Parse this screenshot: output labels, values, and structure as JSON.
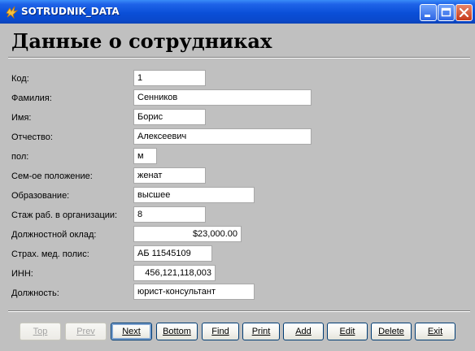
{
  "window": {
    "title": "SOTRUDNIK_DATA",
    "controls": {
      "minimize_icon": "minimize-icon",
      "maximize_icon": "maximize-icon",
      "close_icon": "close-icon"
    }
  },
  "form": {
    "heading": "Данные о сотрудниках",
    "fields": [
      {
        "label": "Код:",
        "value": "1"
      },
      {
        "label": "Фамилия:",
        "value": "Сенников"
      },
      {
        "label": "Имя:",
        "value": "Борис"
      },
      {
        "label": "Отчество:",
        "value": "Алексеевич"
      },
      {
        "label": "пол:",
        "value": "м"
      },
      {
        "label": "Сем-ое положение:",
        "value": "женат"
      },
      {
        "label": "Образование:",
        "value": "высшее"
      },
      {
        "label": "Стаж раб. в организации:",
        "value": "8"
      },
      {
        "label": "Должностной оклад:",
        "value": "$23,000.00"
      },
      {
        "label": "Страх. мед. полис:",
        "value": "АБ 11545109"
      },
      {
        "label": "ИНН:",
        "value": "456,121,118,003"
      },
      {
        "label": "Должность:",
        "value": "юрист-консультант"
      }
    ]
  },
  "buttons": [
    {
      "label": "Top",
      "enabled": false
    },
    {
      "label": "Prev",
      "enabled": false
    },
    {
      "label": "Next",
      "enabled": true
    },
    {
      "label": "Bottom",
      "enabled": true
    },
    {
      "label": "Find",
      "enabled": true
    },
    {
      "label": "Print",
      "enabled": true
    },
    {
      "label": "Add",
      "enabled": true
    },
    {
      "label": "Edit",
      "enabled": true
    },
    {
      "label": "Delete",
      "enabled": true
    },
    {
      "label": "Exit",
      "enabled": true
    }
  ]
}
